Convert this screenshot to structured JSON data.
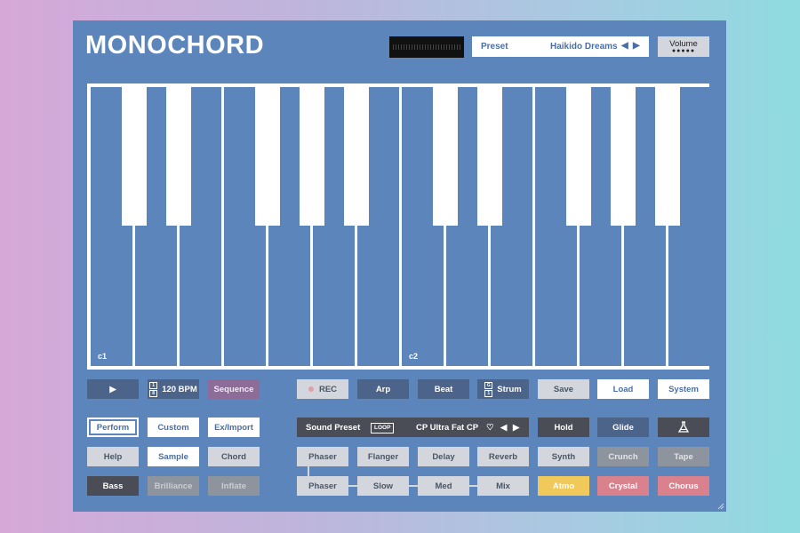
{
  "title": "MONOCHORD",
  "preset": {
    "label": "Preset",
    "value": "Haikido Dreams",
    "prev": "◀",
    "next": "▶"
  },
  "volume": {
    "label": "Volume",
    "dots": "●●●●●"
  },
  "keyboard": {
    "labels": [
      "c1",
      "c2"
    ]
  },
  "transport": {
    "play": "▶",
    "bpm": "120 BPM",
    "sequence": "Sequence",
    "rec": "REC",
    "arp": "Arp",
    "beat": "Beat",
    "strum": "Strum",
    "save": "Save",
    "load": "Load",
    "system": "System",
    "bpm_top": "1",
    "bpm_bottom": "8",
    "strum_top": "G",
    "strum_bottom": "1"
  },
  "modes": {
    "perform": "Perform",
    "custom": "Custom",
    "eximport": "Ex/Import",
    "help": "Help",
    "sample": "Sample",
    "chord": "Chord",
    "bass": "Bass",
    "brilliance": "Brilliance",
    "inflate": "Inflate"
  },
  "sound_preset": {
    "label": "Sound Preset",
    "loop": "LOOP",
    "value": "CP Ultra Fat CP",
    "heart": "♡",
    "prev": "◀",
    "next": "▶"
  },
  "effects_row1": [
    "Phaser",
    "Flanger",
    "Delay",
    "Reverb"
  ],
  "effects_row2": [
    "Phaser",
    "Slow",
    "Med",
    "Mix"
  ],
  "right": {
    "hold": "Hold",
    "glide": "Glide",
    "synth": "Synth",
    "crunch": "Crunch",
    "tape": "Tape",
    "atmo": "Atmo",
    "crystal": "Crystal",
    "chorus": "Chorus"
  },
  "colors": {
    "panel": "#5b85bb",
    "atmo": "#f0c95a",
    "pink": "#d9828e",
    "sequence": "#8d6c9a"
  }
}
